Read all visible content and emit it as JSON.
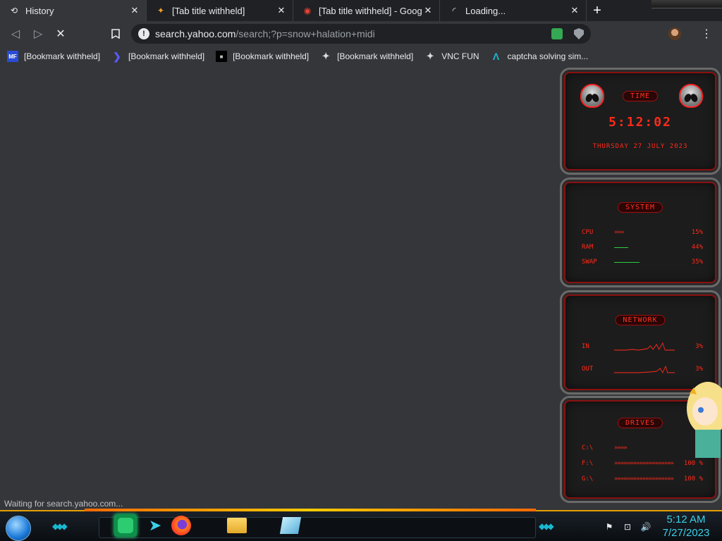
{
  "tabs": [
    {
      "title": "History",
      "icon": "history-icon",
      "close": "✕"
    },
    {
      "title": "[Tab title withheld]",
      "icon": "site-favicon-icon",
      "close": "✕"
    },
    {
      "title": "[Tab title withheld] - Google Se",
      "icon": "google-favicon-icon",
      "close": "✕"
    },
    {
      "title": "Loading...",
      "icon": "loading-spinner-icon",
      "close": "✕"
    }
  ],
  "new_tab": "+",
  "toolbar": {
    "back": "◁",
    "forward": "▷",
    "stop": "✕",
    "bookmark": "🔖",
    "url_host": "search.yahoo.com",
    "url_path": "/search;?p=snow+halation+midi",
    "info": "!",
    "menu": "⋮"
  },
  "bookmarks": [
    {
      "label": "[Bookmark withheld]",
      "icon_text": "MF",
      "icon_color": "#2a4bd8"
    },
    {
      "label": "[Bookmark withheld]",
      "icon_text": "❯",
      "icon_color": "#3a3ad8"
    },
    {
      "label": "[Bookmark withheld]",
      "icon_text": "■",
      "icon_color": "#000000"
    },
    {
      "label": "[Bookmark withheld]",
      "icon_text": "✦",
      "icon_color": "#555555"
    },
    {
      "label": "VNC FUN",
      "icon_text": "✦",
      "icon_color": "#555555"
    },
    {
      "label": "captcha solving sim...",
      "icon_text": "Λ",
      "icon_color": "#1ab8d0"
    }
  ],
  "status": "Waiting for search.yahoo.com...",
  "widgets": {
    "time": {
      "title": "TIME",
      "clock": "5:12:02",
      "date": "THURSDAY 27 JULY 2023"
    },
    "system": {
      "title": "SYSTEM",
      "rows": [
        {
          "label": "CPU",
          "value": "15%"
        },
        {
          "label": "RAM",
          "value": "44%"
        },
        {
          "label": "SWAP",
          "value": "35%"
        }
      ]
    },
    "network": {
      "title": "NETWORK",
      "rows": [
        {
          "label": "IN",
          "value": "3%"
        },
        {
          "label": "OUT",
          "value": "3%"
        }
      ]
    },
    "drives": {
      "title": "DRIVES",
      "rows": [
        {
          "label": "C:\\",
          "value": ""
        },
        {
          "label": "F:\\",
          "value": "100 %"
        },
        {
          "label": "G:\\",
          "value": "100 %"
        }
      ]
    }
  },
  "colors": {
    "widget_red": "#ff2a1a",
    "accent_cyan": "#3ad0e8",
    "taskbar_glow": "#ffcc00"
  },
  "taskbar": {
    "clock_time": "5:12 AM",
    "clock_date": "7/27/2023"
  }
}
